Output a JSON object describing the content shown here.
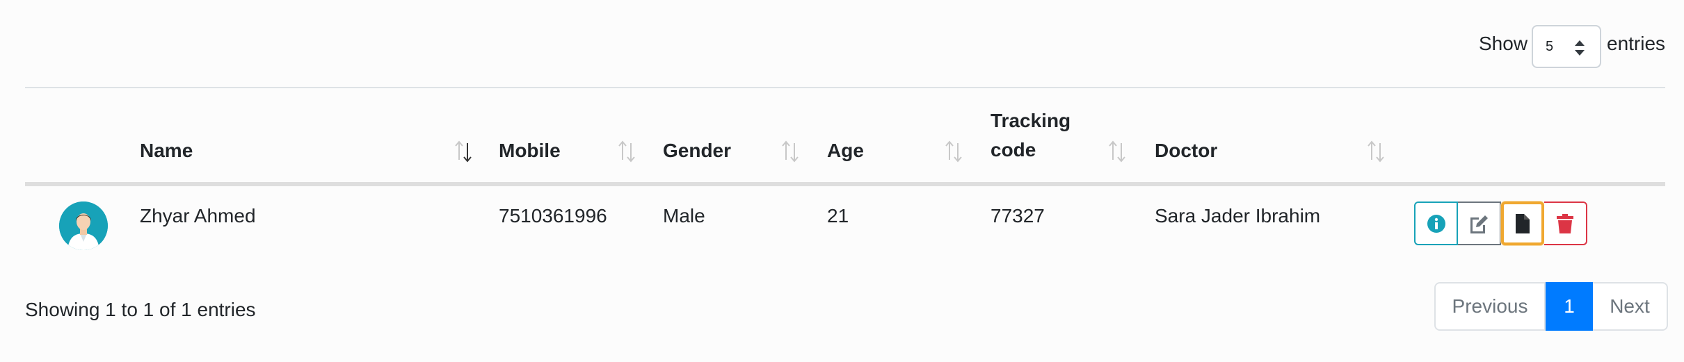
{
  "length_control": {
    "show_label": "Show",
    "selected": "5",
    "entries_label": "entries"
  },
  "table": {
    "columns": [
      {
        "label": "Name"
      },
      {
        "label": "Mobile"
      },
      {
        "label": "Gender"
      },
      {
        "label": "Age"
      },
      {
        "label": "Tracking code"
      },
      {
        "label": "Doctor"
      }
    ],
    "rows": [
      {
        "name": "Zhyar Ahmed",
        "mobile": "7510361996",
        "gender": "Male",
        "age": "21",
        "tracking_code": "77327",
        "doctor": "Sara Jader Ibrahim"
      }
    ]
  },
  "row_actions": [
    "info-icon",
    "edit-icon",
    "document-icon",
    "trash-icon"
  ],
  "info_text": "Showing 1 to 1 of 1 entries",
  "pagination": {
    "previous": "Previous",
    "current": "1",
    "next": "Next"
  },
  "colors": {
    "info": "#17a2b8",
    "danger": "#dc3545",
    "primary": "#007bff",
    "highlight": "#f0a830"
  }
}
